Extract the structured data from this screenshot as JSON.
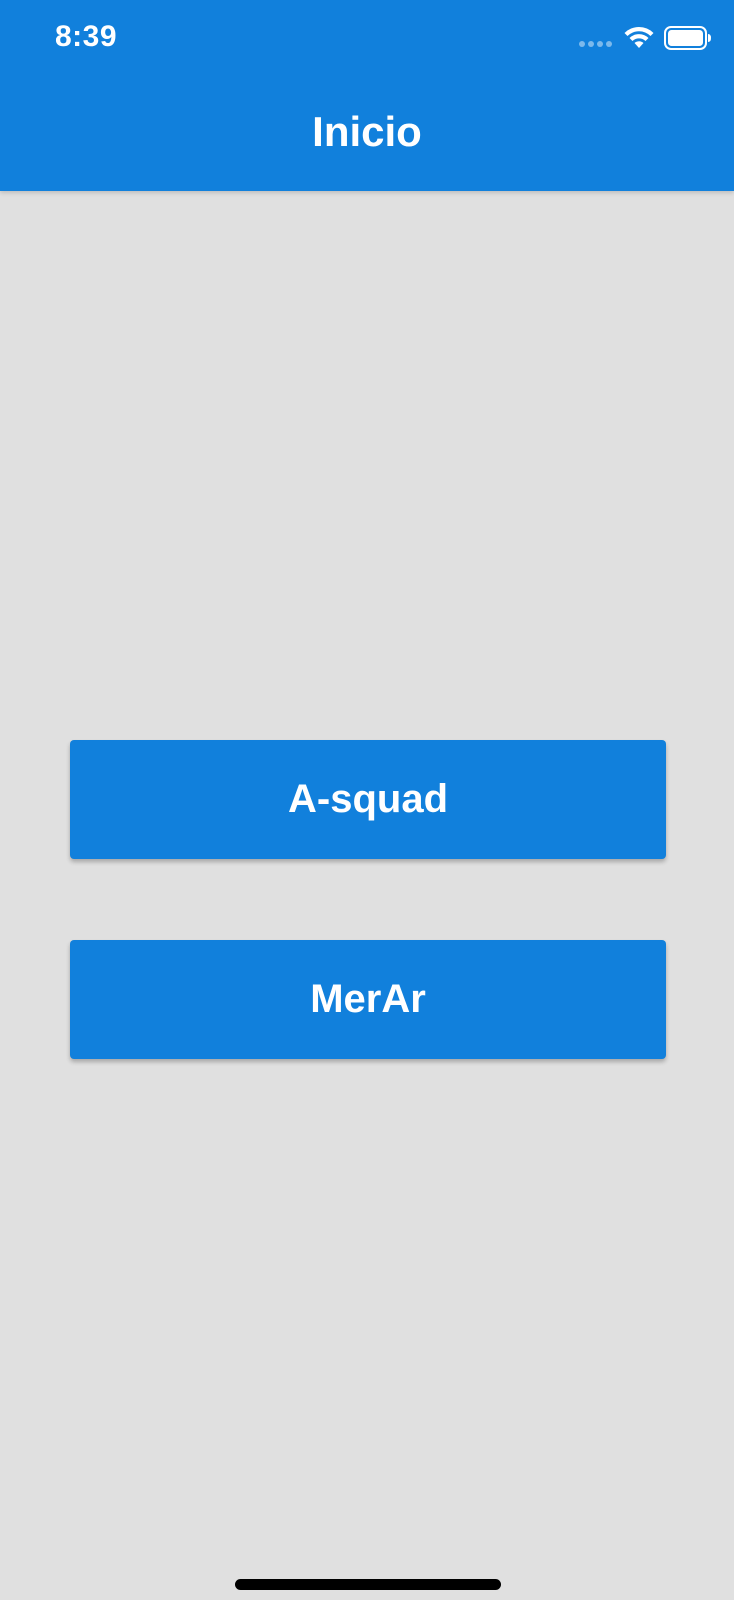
{
  "status_bar": {
    "time": "8:39",
    "icons": [
      "signal-dots-icon",
      "wifi-icon",
      "battery-icon"
    ]
  },
  "header": {
    "title": "Inicio"
  },
  "buttons": [
    {
      "label": "A-squad"
    },
    {
      "label": "MerAr"
    }
  ],
  "colors": {
    "primary": "#1180dc",
    "background": "#e0e0e0",
    "on_primary": "#ffffff"
  }
}
